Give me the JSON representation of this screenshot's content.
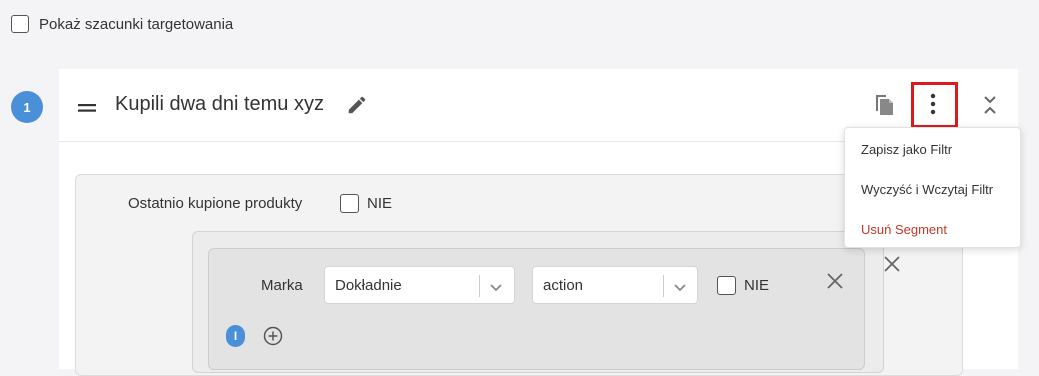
{
  "top": {
    "show_estimates_label": "Pokaż szacunki targetowania"
  },
  "segment": {
    "step_number": "1",
    "title": "Kupili dwa dni temu xyz"
  },
  "filter": {
    "recent_products_label": "Ostatnio kupione produkty",
    "negate_label": "NIE"
  },
  "condition": {
    "field_label": "Marka",
    "operator_value": "Dokładnie",
    "value_value": "action",
    "negate_label": "NIE",
    "logic_badge": "I"
  },
  "menu": {
    "items": [
      {
        "label": "Zapisz jako Filtr"
      },
      {
        "label": "Wyczyść i Wczytaj Filtr"
      },
      {
        "label": "Usuń Segment"
      }
    ]
  },
  "colors": {
    "accent": "#4a90d9",
    "danger": "#c0392b",
    "highlight": "#e0181b"
  },
  "icons": [
    "drag-handle-icon",
    "pencil-icon",
    "copy-icon",
    "more-vertical-icon",
    "collapse-icon",
    "close-icon",
    "chevron-down-icon",
    "add-circle-icon"
  ]
}
